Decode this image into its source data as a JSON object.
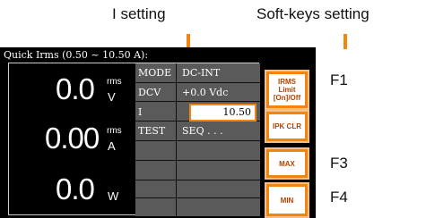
{
  "callouts": {
    "i_setting": "I setting",
    "softkeys_setting": "Soft-keys setting"
  },
  "fkeys": [
    "F1",
    "F3",
    "F4"
  ],
  "screen": {
    "title": "Quick Irms (0.50 ~ 10.50 A):",
    "readings": [
      {
        "value": "0.0",
        "sup": "rms",
        "unit": "V"
      },
      {
        "value": "0.00",
        "sup": "rms",
        "unit": "A"
      },
      {
        "value": "0.0",
        "sup": "",
        "unit": "W"
      }
    ],
    "params": [
      {
        "label": "MODE",
        "value": "DC-INT"
      },
      {
        "label": "DCV",
        "value": "+0.0 Vdc"
      },
      {
        "label": "I",
        "value": "10.50"
      },
      {
        "label": "TEST",
        "value": "SEQ . . ."
      }
    ]
  },
  "softkeys": {
    "f1": [
      "IRMS",
      "Limit",
      "[On]/Off"
    ],
    "f2": "IPK CLR",
    "f3": "MAX",
    "f4": "MIN"
  },
  "colors": {
    "accent": "#f0850f",
    "screen_bg": "#000000",
    "param_bg": "#5a5a5a"
  }
}
